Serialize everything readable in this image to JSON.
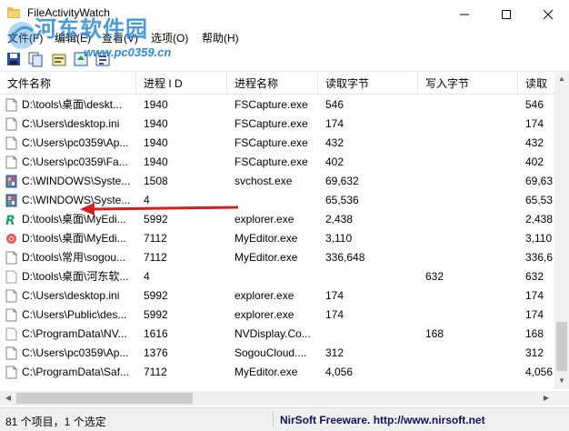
{
  "window": {
    "title": "FileActivityWatch",
    "min_icon": "minimize-icon",
    "max_icon": "maximize-icon",
    "close_icon": "close-icon"
  },
  "watermark": {
    "title": "河东软件园",
    "url": "www.pc0359.cn"
  },
  "menu": [
    {
      "label": "文件(F)"
    },
    {
      "label": "编辑(E)"
    },
    {
      "label": "查看(V)"
    },
    {
      "label": "选项(O)"
    },
    {
      "label": "帮助(H)"
    }
  ],
  "toolbar": [
    "save-icon",
    "copy-icon",
    "properties-icon",
    "refresh-icon",
    "about-icon"
  ],
  "columns": [
    "文件名称",
    "进程 I D",
    "进程名称",
    "读取字节",
    "写入字节",
    "读取"
  ],
  "rows": [
    {
      "icon": "doc",
      "file": "D:\\tools\\桌面\\deskt...",
      "pid": "1940",
      "proc": "FSCapture.exe",
      "read": "546",
      "write": "",
      "read2": "546"
    },
    {
      "icon": "doc",
      "file": "C:\\Users\\desktop.ini",
      "pid": "1940",
      "proc": "FSCapture.exe",
      "read": "174",
      "write": "",
      "read2": "174"
    },
    {
      "icon": "doc",
      "file": "C:\\Users\\pc0359\\Ap...",
      "pid": "1940",
      "proc": "FSCapture.exe",
      "read": "432",
      "write": "",
      "read2": "432"
    },
    {
      "icon": "doc",
      "file": "C:\\Users\\pc0359\\Fa...",
      "pid": "1940",
      "proc": "FSCapture.exe",
      "read": "402",
      "write": "",
      "read2": "402"
    },
    {
      "icon": "sys",
      "file": "C:\\WINDOWS\\Syste...",
      "pid": "1508",
      "proc": "svchost.exe",
      "read": "69,632",
      "write": "",
      "read2": "69,63"
    },
    {
      "icon": "sys",
      "file": "C:\\WINDOWS\\Syste...",
      "pid": "4",
      "proc": "",
      "read": "65,536",
      "write": "",
      "read2": "65,53"
    },
    {
      "icon": "r",
      "file": "D:\\tools\\桌面\\MyEdi...",
      "pid": "5992",
      "proc": "explorer.exe",
      "read": "2,438",
      "write": "",
      "read2": "2,438"
    },
    {
      "icon": "color",
      "file": "D:\\tools\\桌面\\MyEdi...",
      "pid": "7112",
      "proc": "MyEditor.exe",
      "read": "3,110",
      "write": "",
      "read2": "3,110"
    },
    {
      "icon": "doc",
      "file": "D:\\tools\\常用\\sogou...",
      "pid": "7112",
      "proc": "MyEditor.exe",
      "read": "336,648",
      "write": "",
      "read2": "336,6"
    },
    {
      "icon": "blank",
      "file": "D:\\tools\\桌面\\河东软...",
      "pid": "4",
      "proc": "",
      "read": "",
      "write": "632",
      "read2": "632"
    },
    {
      "icon": "doc",
      "file": "C:\\Users\\desktop.ini",
      "pid": "5992",
      "proc": "explorer.exe",
      "read": "174",
      "write": "",
      "read2": "174"
    },
    {
      "icon": "doc",
      "file": "C:\\Users\\Public\\des...",
      "pid": "5992",
      "proc": "explorer.exe",
      "read": "174",
      "write": "",
      "read2": "174"
    },
    {
      "icon": "blank",
      "file": "C:\\ProgramData\\NV...",
      "pid": "1616",
      "proc": "NVDisplay.Co...",
      "read": "",
      "write": "168",
      "read2": "168"
    },
    {
      "icon": "doc",
      "file": "C:\\Users\\pc0359\\Ap...",
      "pid": "1376",
      "proc": "SogouCloud....",
      "read": "312",
      "write": "",
      "read2": "312"
    },
    {
      "icon": "doc",
      "file": "C:\\ProgramData\\Saf...",
      "pid": "7112",
      "proc": "MyEditor.exe",
      "read": "4,056",
      "write": "",
      "read2": "4,056"
    }
  ],
  "status": {
    "count": "81 个项目，1 个选定",
    "credit": "NirSoft Freeware.  http://www.nirsoft.net"
  },
  "colors": {
    "annotation_arrow": "#d42020",
    "watermark": "#2a8ad6"
  }
}
